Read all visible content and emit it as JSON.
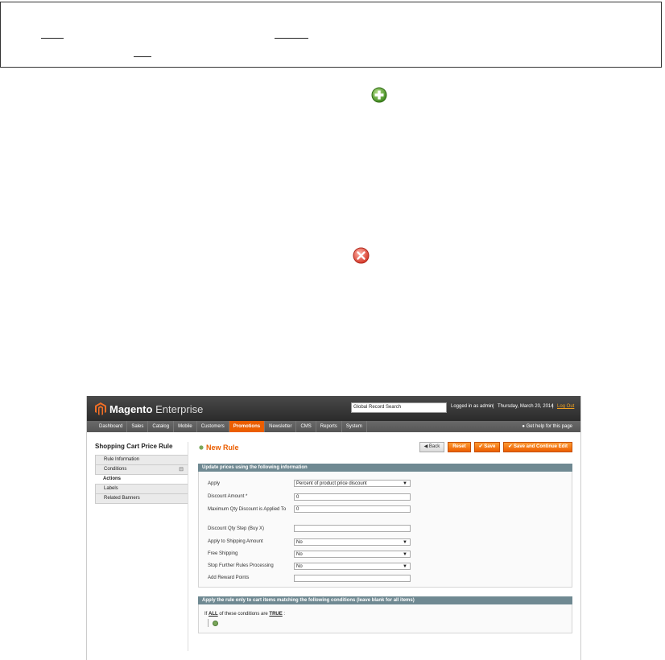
{
  "header": {
    "logo_brand": "Magento",
    "logo_edition": "Enterprise",
    "search_value": "Global Record Search",
    "logged_in": "Logged in as admin",
    "date": "Thursday, March 20, 2014",
    "logout": "Log Out",
    "help": "Get help for this page"
  },
  "nav": [
    "Dashboard",
    "Sales",
    "Catalog",
    "Mobile",
    "Customers",
    "Promotions",
    "Newsletter",
    "CMS",
    "Reports",
    "System"
  ],
  "sidebar": {
    "title": "Shopping Cart Price Rule",
    "tabs": [
      "Rule Information",
      "Conditions",
      "Actions",
      "Labels",
      "Related Banners"
    ]
  },
  "main": {
    "title": "New Rule",
    "buttons": {
      "back": "Back",
      "reset": "Reset",
      "save": "Save",
      "save_continue": "Save and Continue Edit"
    },
    "section1_title": "Update prices using the following information",
    "fields": [
      {
        "label": "Apply",
        "value": "Percent of product price discount",
        "type": "select"
      },
      {
        "label": "Discount Amount *",
        "value": "0",
        "type": "input"
      },
      {
        "label": "Maximum Qty Discount is Applied To",
        "value": "0",
        "type": "input"
      },
      {
        "label": "Discount Qty Step (Buy X)",
        "value": "",
        "type": "input"
      },
      {
        "label": "Apply to Shipping Amount",
        "value": "No",
        "type": "select"
      },
      {
        "label": "Free Shipping",
        "value": "No",
        "type": "select"
      },
      {
        "label": "Stop Further Rules Processing",
        "value": "No",
        "type": "select"
      },
      {
        "label": "Add Reward Points",
        "value": "",
        "type": "input"
      }
    ],
    "section2_title": "Apply the rule only to cart items matching the following conditions (leave blank for all items)",
    "cond_if": "If",
    "cond_all": "ALL",
    "cond_mid": "of these conditions are",
    "cond_true": "TRUE",
    "cond_end": ":"
  },
  "colors": {
    "accent": "#eb5e00",
    "section_header": "#6f8992",
    "add_icon": "#5aa832",
    "remove_icon": "#e0473a"
  }
}
